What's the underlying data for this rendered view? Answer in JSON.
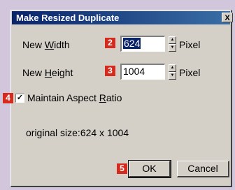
{
  "dialog": {
    "title": "Make Resized Duplicate",
    "close_glyph": "X"
  },
  "width_row": {
    "label_pre": "New ",
    "label_ul": "W",
    "label_post": "idth",
    "badge": "2",
    "value": "624",
    "unit": "Pixel"
  },
  "height_row": {
    "label_pre": "New ",
    "label_ul": "H",
    "label_post": "eight",
    "badge": "3",
    "value": "1004",
    "unit": "Pixel"
  },
  "aspect": {
    "badge": "4",
    "checked": true,
    "label_pre": "Maintain Aspect ",
    "label_ul": "R",
    "label_post": "atio"
  },
  "info": {
    "original_size": "original size:624 x 1004"
  },
  "buttons": {
    "ok_badge": "5",
    "ok_label": "OK",
    "cancel_label": "Cancel"
  },
  "colors": {
    "badge": "#d52b1e",
    "titlebar": "#0a246a",
    "backdrop": "#d2c6dc"
  }
}
